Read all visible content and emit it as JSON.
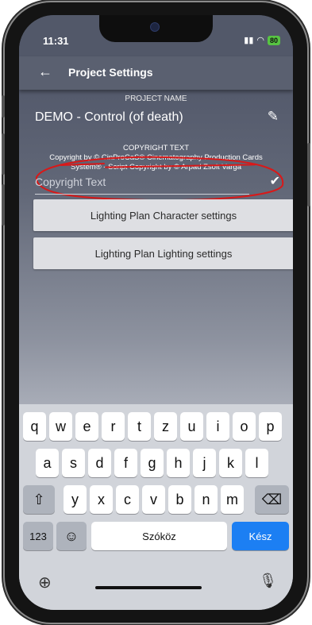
{
  "status_bar": {
    "time": "11:31",
    "battery": "80"
  },
  "app_bar": {
    "title": "Project Settings"
  },
  "project": {
    "name_label": "PROJECT NAME",
    "name": "DEMO - Control (of death)",
    "copyright_label": "COPYRIGHT TEXT",
    "copyright_line1": "Copyright by © CinProCaS® Cinematography Production Cards",
    "copyright_line2": "System® - Script Copyright by © Arpad Zsolt Varga"
  },
  "copyright_input": {
    "placeholder": "Copyright Text",
    "value": ""
  },
  "buttons": {
    "character_settings": "Lighting Plan Character settings",
    "lighting_settings": "Lighting Plan Lighting settings"
  },
  "keyboard": {
    "row1": [
      "q",
      "w",
      "e",
      "r",
      "t",
      "z",
      "u",
      "i",
      "o",
      "p"
    ],
    "row2": [
      "a",
      "s",
      "d",
      "f",
      "g",
      "h",
      "j",
      "k",
      "l"
    ],
    "row3": [
      "y",
      "x",
      "c",
      "v",
      "b",
      "n",
      "m"
    ],
    "numbers": "123",
    "space": "Szóköz",
    "done": "Kész"
  },
  "icons": {
    "back": "arrow-left-icon",
    "edit": "pencil-icon",
    "check": "check-icon",
    "shift": "shift-icon",
    "backspace": "backspace-icon",
    "emoji": "emoji-icon",
    "globe": "globe-icon",
    "mic": "mic-icon"
  },
  "colors": {
    "annotation": "#d81919",
    "done_key": "#1c7ff3",
    "battery": "#57c442"
  }
}
